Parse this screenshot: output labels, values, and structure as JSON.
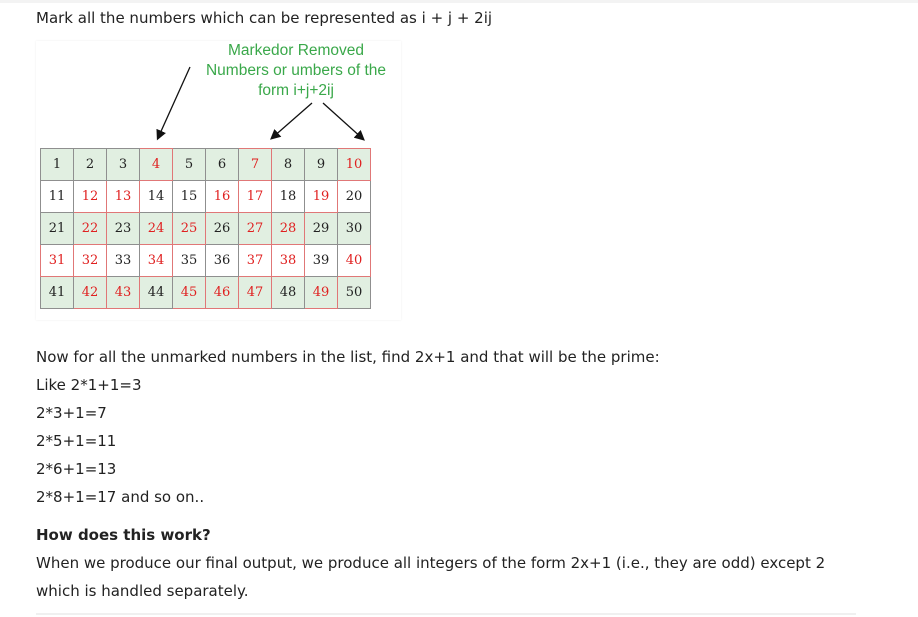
{
  "intro": "Mark all the numbers which can be represented as i + j + 2ij",
  "figure": {
    "annotation_lines": [
      "Markedor Removed",
      "Numbers or umbers of the",
      "form i+j+2ij"
    ],
    "colors": {
      "annotation": "#3aa84a",
      "marked": "#e02020",
      "shaded_row": "#e1efe1"
    },
    "rows": [
      [
        "1",
        "2",
        "3",
        "4",
        "5",
        "6",
        "7",
        "8",
        "9",
        "10"
      ],
      [
        "11",
        "12",
        "13",
        "14",
        "15",
        "16",
        "17",
        "18",
        "19",
        "20"
      ],
      [
        "21",
        "22",
        "23",
        "24",
        "25",
        "26",
        "27",
        "28",
        "29",
        "30"
      ],
      [
        "31",
        "32",
        "33",
        "34",
        "35",
        "36",
        "37",
        "38",
        "39",
        "40"
      ],
      [
        "41",
        "42",
        "43",
        "44",
        "45",
        "46",
        "47",
        "48",
        "49",
        "50"
      ]
    ],
    "marked": [
      4,
      7,
      10,
      12,
      13,
      16,
      17,
      19,
      22,
      24,
      25,
      27,
      28,
      31,
      32,
      34,
      37,
      38,
      40,
      42,
      43,
      45,
      46,
      47,
      49
    ]
  },
  "after_figure": "Now for all the unmarked numbers in the list, find 2x+1 and that will be the prime:",
  "examples": [
    "Like 2*1+1=3",
    "2*3+1=7",
    "2*5+1=11",
    "2*6+1=13",
    "2*8+1=17 and so on.."
  ],
  "heading": "How does this work?",
  "explanation": [
    "When we produce our final output, we produce all integers of the form 2x+1 (i.e., they are odd) except 2",
    "which is handled separately."
  ]
}
